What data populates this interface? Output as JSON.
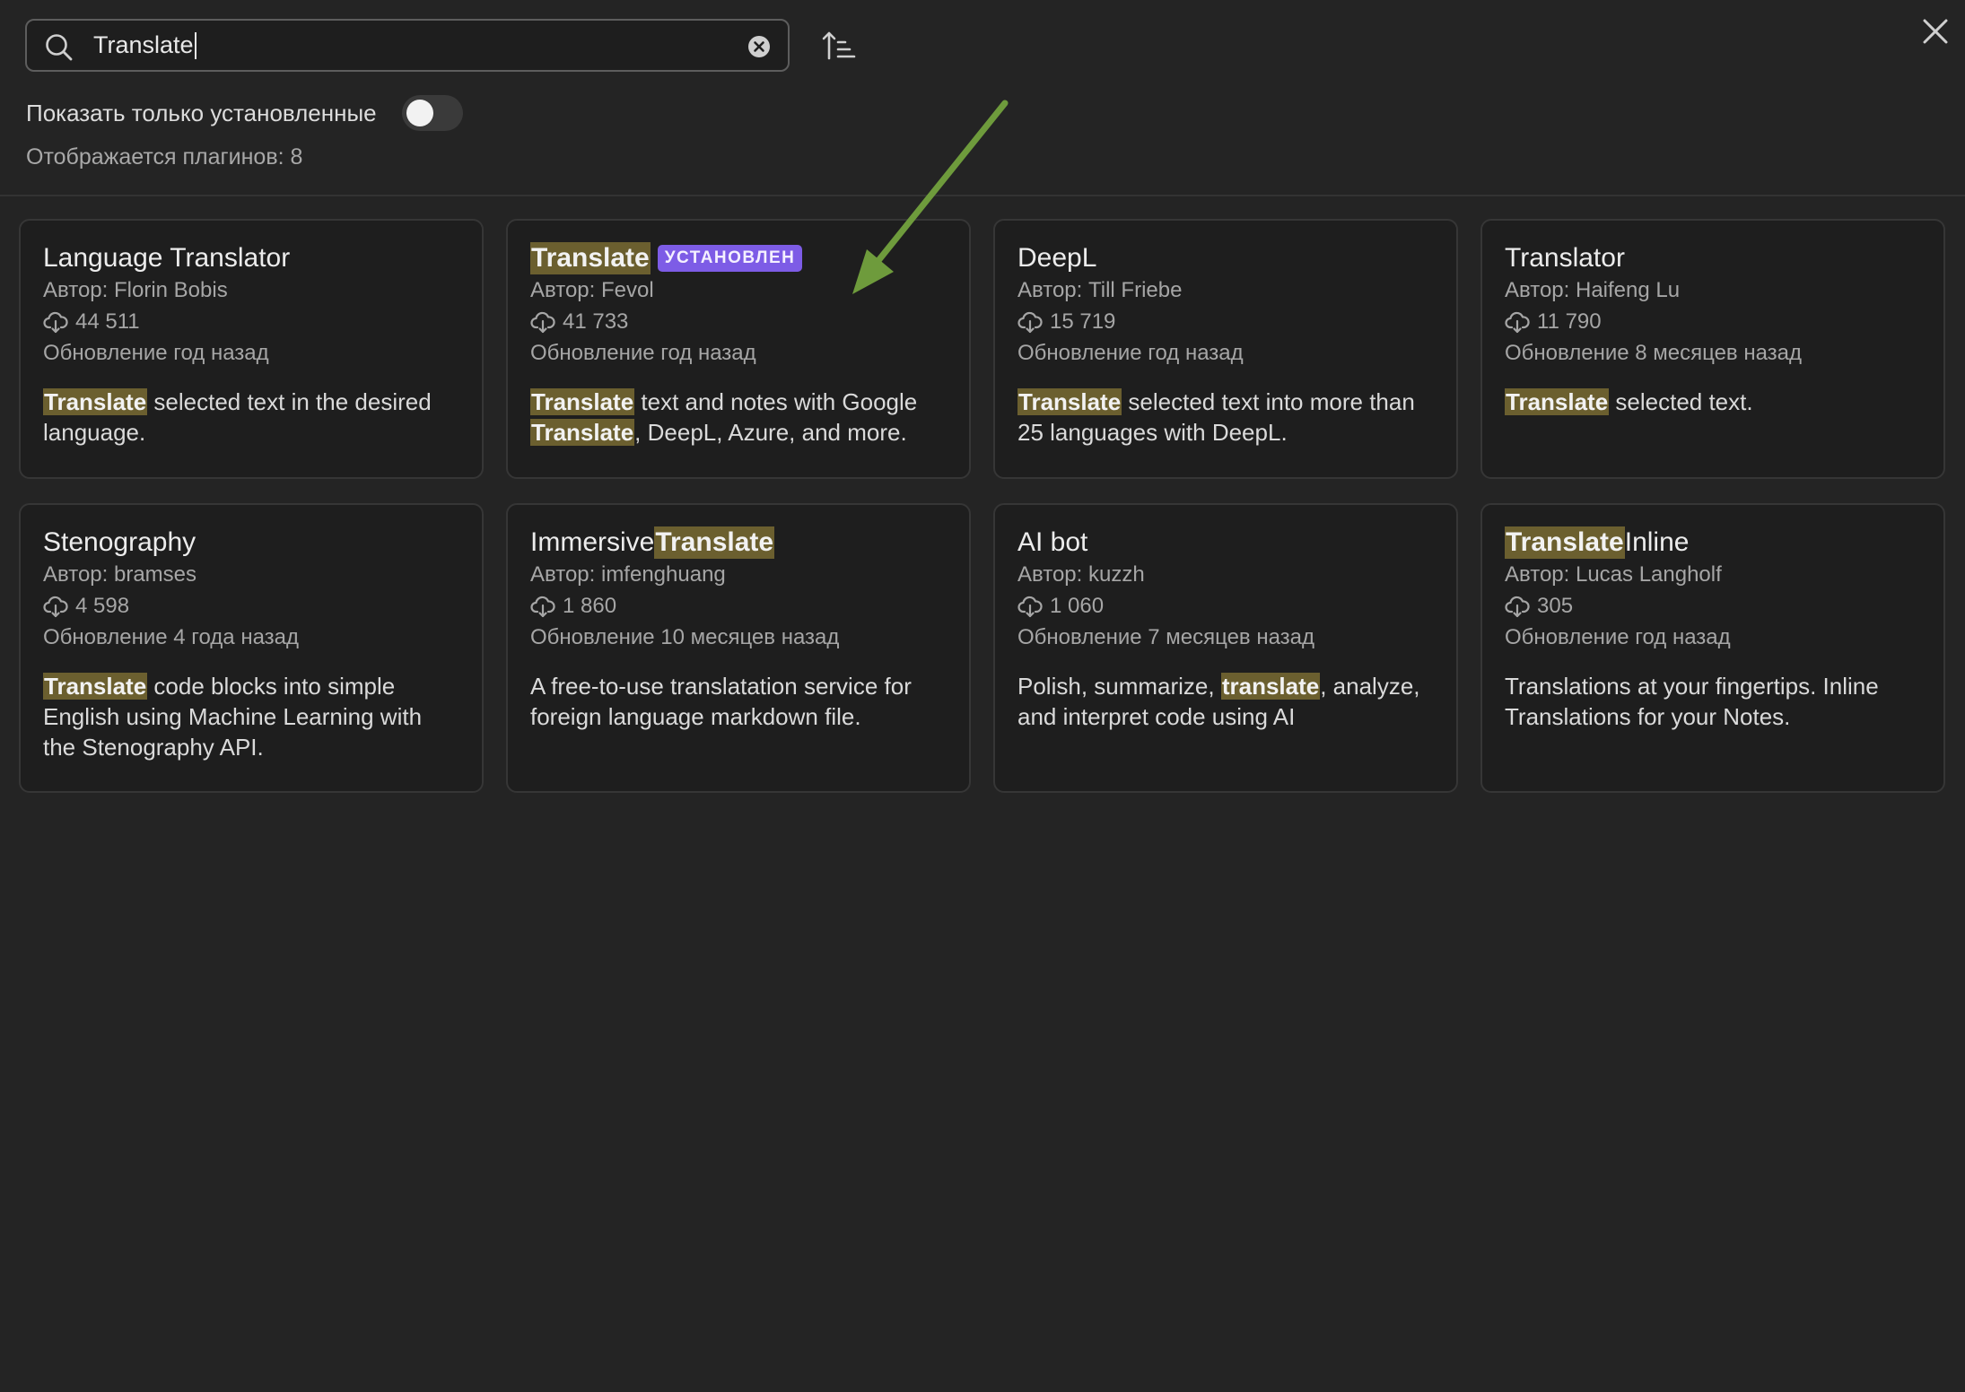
{
  "search": {
    "value": "Translate"
  },
  "filter": {
    "installed_only_label": "Показать только установленные",
    "installed_only_on": false
  },
  "count_text": "Отображается плагинов: 8",
  "colors": {
    "highlight": "#6b5f2f",
    "badge": "#7d5ce6",
    "arrow": "#6e9b3c"
  },
  "plugins": [
    {
      "title": [
        {
          "t": "Language Translator",
          "h": false
        }
      ],
      "badge": "",
      "author": "Автор: Florin Bobis",
      "downloads": "44 511",
      "updated": "Обновление год назад",
      "description": [
        {
          "t": "Translate",
          "h": true
        },
        {
          "t": " selected text in the desired language.",
          "h": false
        }
      ]
    },
    {
      "title": [
        {
          "t": "Translate",
          "h": true
        }
      ],
      "badge": "УСТАНОВЛЕН",
      "author": "Автор: Fevol",
      "downloads": "41 733",
      "updated": "Обновление год назад",
      "description": [
        {
          "t": "Translate",
          "h": true
        },
        {
          "t": " text and notes with Google ",
          "h": false
        },
        {
          "t": "Translate",
          "h": true
        },
        {
          "t": ", DeepL, Azure, and more.",
          "h": false
        }
      ]
    },
    {
      "title": [
        {
          "t": "DeepL",
          "h": false
        }
      ],
      "badge": "",
      "author": "Автор: Till Friebe",
      "downloads": "15 719",
      "updated": "Обновление год назад",
      "description": [
        {
          "t": "Translate",
          "h": true
        },
        {
          "t": " selected text into more than 25 languages with DeepL.",
          "h": false
        }
      ]
    },
    {
      "title": [
        {
          "t": "Translator",
          "h": false
        }
      ],
      "badge": "",
      "author": "Автор: Haifeng Lu",
      "downloads": "11 790",
      "updated": "Обновление 8 месяцев назад",
      "description": [
        {
          "t": "Translate",
          "h": true
        },
        {
          "t": " selected text.",
          "h": false
        }
      ]
    },
    {
      "title": [
        {
          "t": "Stenography",
          "h": false
        }
      ],
      "badge": "",
      "author": "Автор: bramses",
      "downloads": "4 598",
      "updated": "Обновление 4 года назад",
      "description": [
        {
          "t": "Translate",
          "h": true
        },
        {
          "t": " code blocks into simple English using Machine Learning with the Stenography API.",
          "h": false
        }
      ]
    },
    {
      "title": [
        {
          "t": "Immersive ",
          "h": false
        },
        {
          "t": "Translate",
          "h": true
        }
      ],
      "badge": "",
      "author": "Автор: imfenghuang",
      "downloads": "1 860",
      "updated": "Обновление 10 месяцев назад",
      "description": [
        {
          "t": "A free-to-use translatation service for foreign language markdown file.",
          "h": false
        }
      ]
    },
    {
      "title": [
        {
          "t": "AI bot",
          "h": false
        }
      ],
      "badge": "",
      "author": "Автор: kuzzh",
      "downloads": "1 060",
      "updated": "Обновление 7 месяцев назад",
      "description": [
        {
          "t": "Polish, summarize, ",
          "h": false
        },
        {
          "t": "translate",
          "h": true
        },
        {
          "t": ", analyze, and interpret code using AI",
          "h": false
        }
      ]
    },
    {
      "title": [
        {
          "t": "Translate",
          "h": true
        },
        {
          "t": " Inline",
          "h": false
        }
      ],
      "badge": "",
      "author": "Автор: Lucas Langholf",
      "downloads": "305",
      "updated": "Обновление год назад",
      "description": [
        {
          "t": "Translations at your fingertips. Inline Translations for your Notes.",
          "h": false
        }
      ]
    }
  ]
}
